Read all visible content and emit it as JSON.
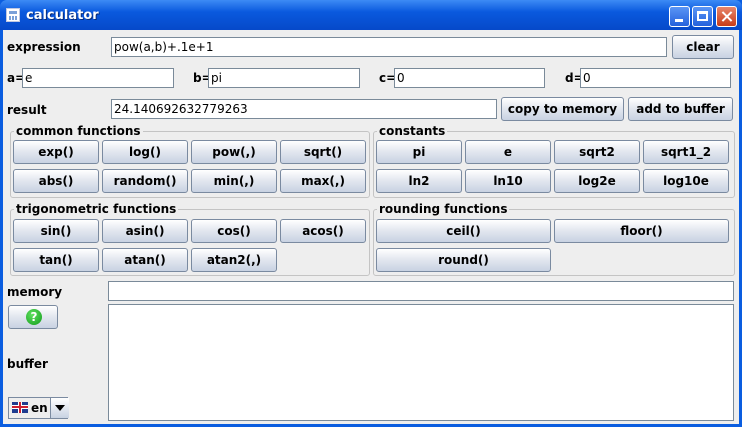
{
  "window": {
    "title": "calculator"
  },
  "expression": {
    "label": "expression",
    "value": "pow(a,b)+.1e+1",
    "clear_label": "clear"
  },
  "variables": [
    {
      "label": "a=",
      "value": "e"
    },
    {
      "label": "b=",
      "value": "pi"
    },
    {
      "label": "c=",
      "value": "0"
    },
    {
      "label": "d=",
      "value": "0"
    }
  ],
  "result": {
    "label": "result",
    "value": "24.140692632779263",
    "copy_label": "copy to memory",
    "add_label": "add to buffer"
  },
  "common_functions": {
    "title": "common functions",
    "buttons": [
      "exp()",
      "log()",
      "pow(,)",
      "sqrt()",
      "abs()",
      "random()",
      "min(,)",
      "max(,)"
    ]
  },
  "constants": {
    "title": "constants",
    "buttons": [
      "pi",
      "e",
      "sqrt2",
      "sqrt1_2",
      "ln2",
      "ln10",
      "log2e",
      "log10e"
    ]
  },
  "trig_functions": {
    "title": "trigonometric functions",
    "buttons": [
      "sin()",
      "asin()",
      "cos()",
      "acos()",
      "tan()",
      "atan()",
      "atan2(,)"
    ]
  },
  "rounding_functions": {
    "title": "rounding functions",
    "buttons": [
      "ceil()",
      "floor()",
      "round()"
    ]
  },
  "memory": {
    "label": "memory",
    "value": ""
  },
  "buffer": {
    "label": "buffer",
    "value": ""
  },
  "help": {
    "icon": "question-icon",
    "glyph": "?"
  },
  "language": {
    "value": "en"
  }
}
